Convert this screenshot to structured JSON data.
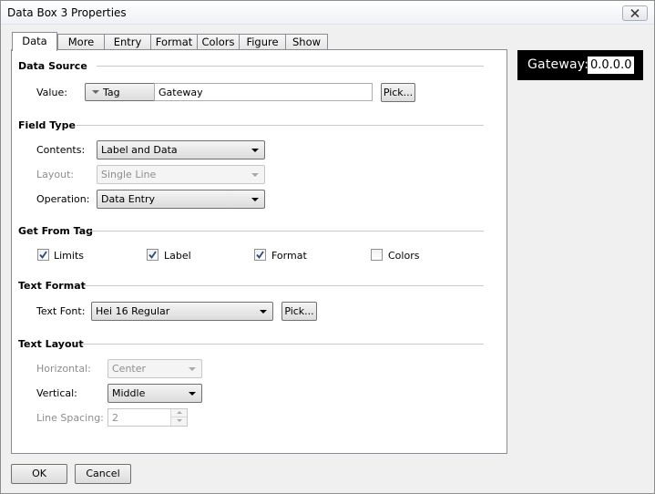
{
  "window": {
    "title": "Data Box 3 Properties"
  },
  "tabs": [
    {
      "label": "Data",
      "active": true
    },
    {
      "label": "More"
    },
    {
      "label": "Entry"
    },
    {
      "label": "Format"
    },
    {
      "label": "Colors"
    },
    {
      "label": "Figure"
    },
    {
      "label": "Show"
    }
  ],
  "data_source": {
    "title": "Data Source",
    "value_label": "Value:",
    "value_type": "Tag",
    "value_text": "Gateway",
    "pick_label": "Pick..."
  },
  "field_type": {
    "title": "Field Type",
    "contents_label": "Contents:",
    "contents_value": "Label and Data",
    "layout_label": "Layout:",
    "layout_value": "Single Line",
    "operation_label": "Operation:",
    "operation_value": "Data Entry"
  },
  "get_from_tag": {
    "title": "Get From Tag",
    "limits_label": "Limits",
    "limits_checked": true,
    "label_label": "Label",
    "label_checked": true,
    "format_label": "Format",
    "format_checked": true,
    "colors_label": "Colors",
    "colors_checked": false
  },
  "text_format": {
    "title": "Text Format",
    "font_label": "Text Font:",
    "font_value": "Hei 16 Regular",
    "pick_label": "Pick..."
  },
  "text_layout": {
    "title": "Text Layout",
    "horizontal_label": "Horizontal:",
    "horizontal_value": "Center",
    "vertical_label": "Vertical:",
    "vertical_value": "Middle",
    "spacing_label": "Line Spacing:",
    "spacing_value": "2"
  },
  "preview": {
    "label": "Gateway:",
    "data": "0.0.0.0"
  },
  "buttons": {
    "ok": "OK",
    "cancel": "Cancel"
  },
  "icons": {
    "close": "close-icon",
    "dropdown": "chevron-down-icon",
    "check": "checkmark-icon"
  }
}
